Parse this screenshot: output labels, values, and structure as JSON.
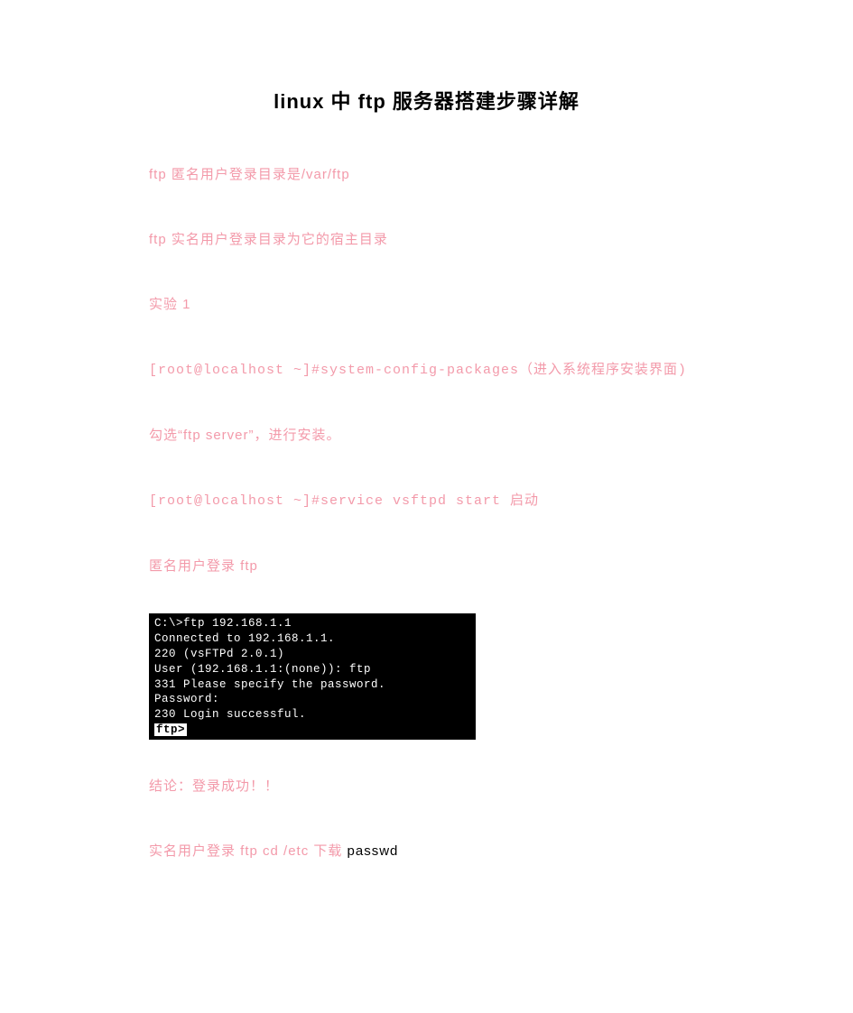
{
  "title": "linux 中 ftp 服务器搭建步骤详解",
  "paragraphs": {
    "p1": "ftp 匿名用户登录目录是/var/ftp",
    "p2": "ftp 实名用户登录目录为它的宿主目录",
    "p3": "实验 1",
    "p4": "[root@localhost ~]#system-config-packages（进入系统程序安装界面)",
    "p5": "勾选“ftp server”，进行安装。",
    "p6": "[root@localhost ~]#service vsftpd start    启动",
    "p7": "匿名用户登录 ftp",
    "p8": "结论：登录成功！！",
    "p9_pink": "实名用户登录 ftp    cd /etc 下载",
    "p9_black": " passwd"
  },
  "terminal": {
    "l1": "C:\\>ftp 192.168.1.1",
    "l2": "Connected to 192.168.1.1.",
    "l3": "220 (vsFTPd 2.0.1)",
    "l4": "User (192.168.1.1:(none)): ftp",
    "l5": "331 Please specify the password.",
    "l6": "Password:",
    "l7": "230 Login successful.",
    "l8_prompt": "ftp>"
  }
}
